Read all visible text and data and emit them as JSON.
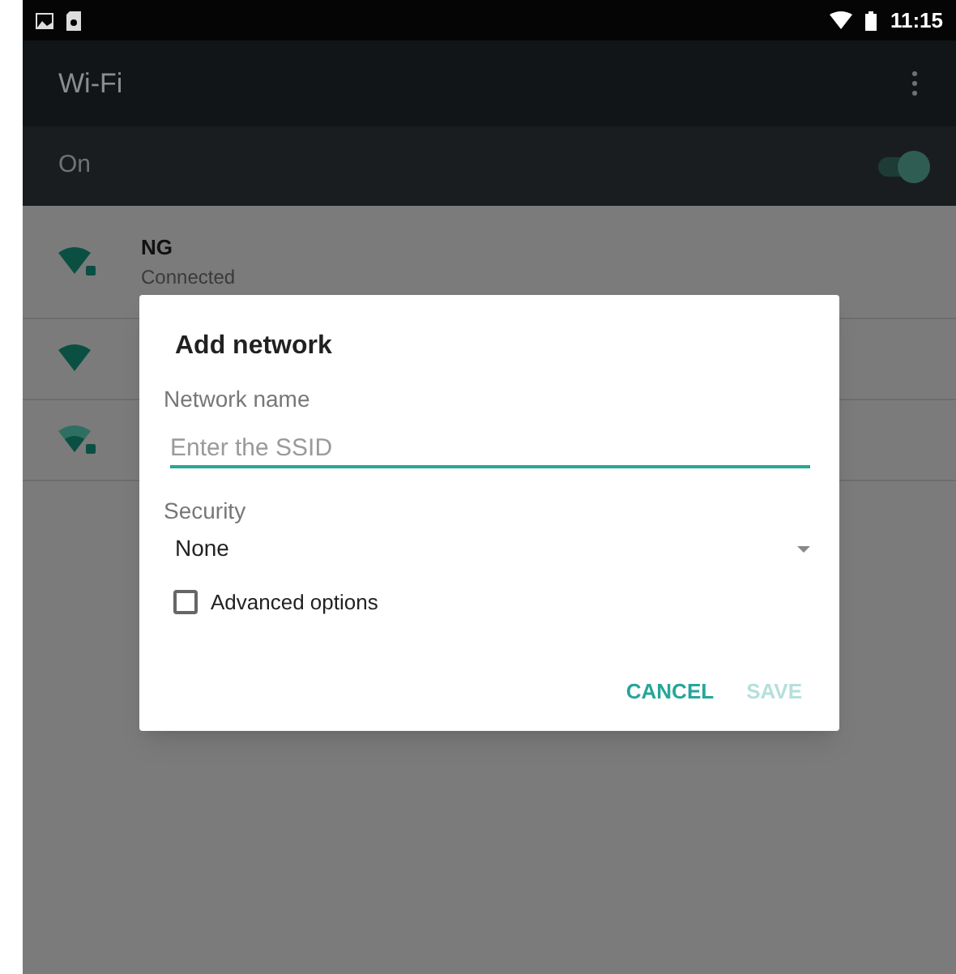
{
  "status_bar": {
    "time": "11:15"
  },
  "toolbar": {
    "title": "Wi-Fi"
  },
  "master_switch": {
    "label": "On",
    "on": true
  },
  "networks": [
    {
      "name": "NG",
      "status": "Connected",
      "secured": true,
      "kind": "strong"
    },
    {
      "secured": false,
      "kind": "strong"
    },
    {
      "secured": true,
      "kind": "weak"
    }
  ],
  "dialog": {
    "title": "Add network",
    "network_name": {
      "label": "Network name",
      "placeholder": "Enter the SSID"
    },
    "security": {
      "label": "Security",
      "value": "None"
    },
    "advanced_options": {
      "label": "Advanced options",
      "checked": false
    },
    "buttons": [
      {
        "label": "CANCEL",
        "disabled": false
      },
      {
        "label": "SAVE",
        "disabled": true
      }
    ]
  }
}
